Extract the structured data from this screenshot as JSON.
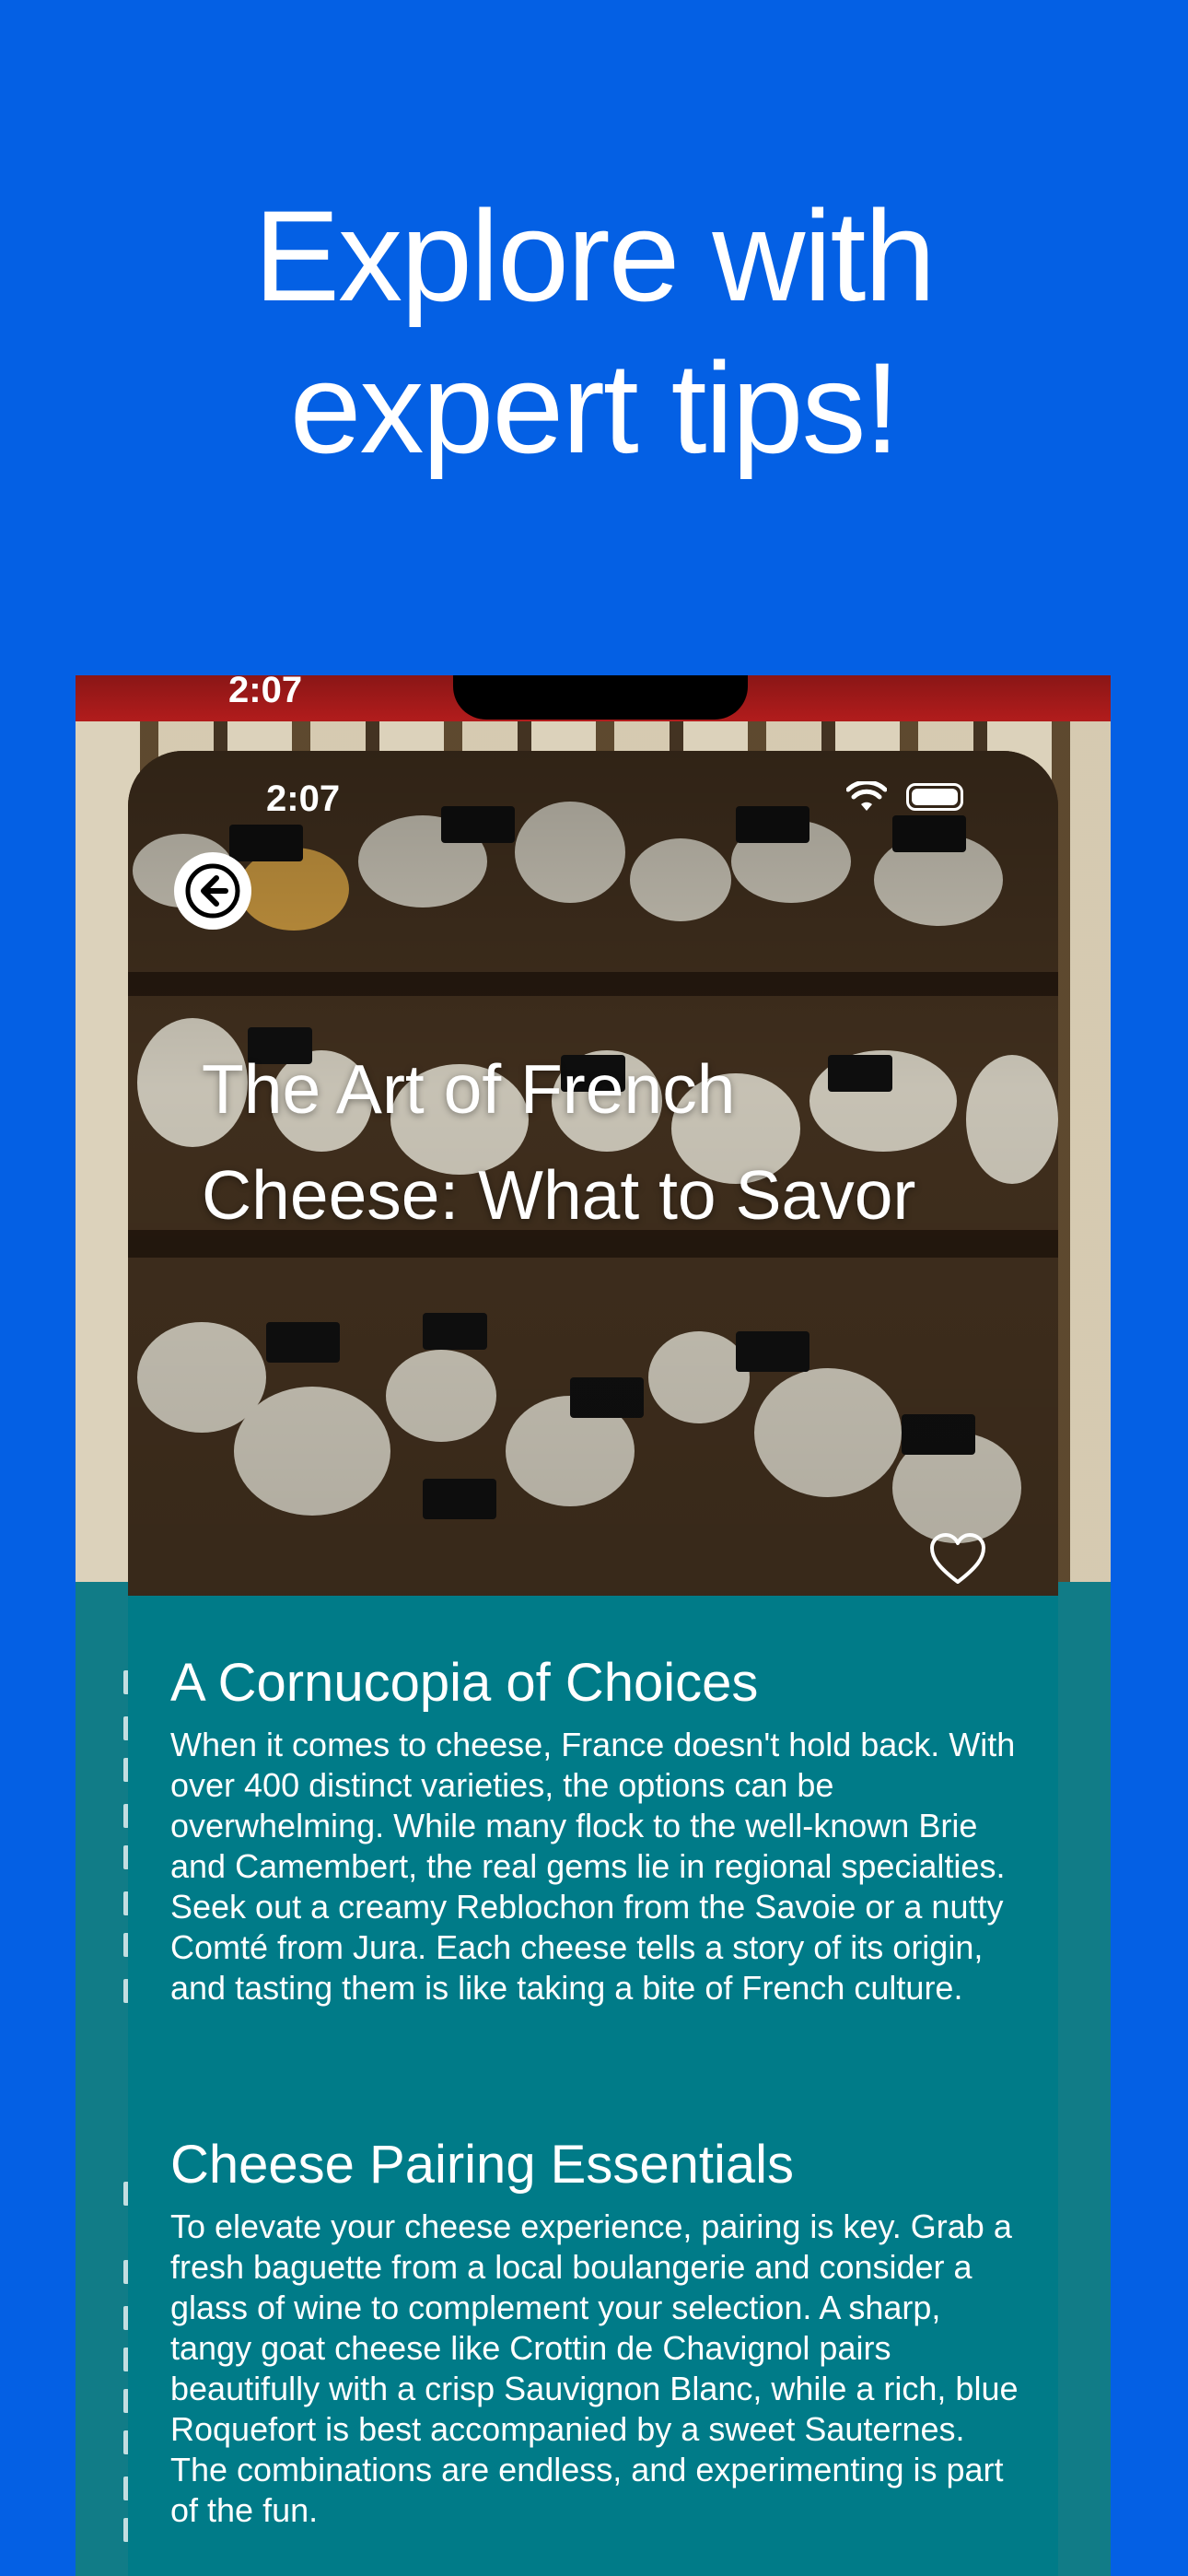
{
  "headline": {
    "line1": "Explore with",
    "line2": "expert tips!"
  },
  "back_device": {
    "time": "2:07"
  },
  "status_bar": {
    "time": "2:07"
  },
  "article": {
    "title_line1": "The Art of French",
    "title_line2": "Cheese: What to Savor",
    "sections": [
      {
        "heading": "A Cornucopia of Choices",
        "body": "When it comes to cheese, France doesn't hold back. With over 400 distinct varieties, the options can be overwhelming. While many flock to the well-known Brie and Camembert, the real gems lie in regional specialties. Seek out a creamy Reblochon from the Savoie or a nutty Comté from Jura. Each cheese tells a story of its origin, and tasting them is like taking a bite of French culture."
      },
      {
        "heading": "Cheese Pairing Essentials",
        "body": "To elevate your cheese experience, pairing is key. Grab a fresh baguette from a local boulangerie and consider a glass of wine to complement your selection. A sharp, tangy goat cheese like Crottin de Chavignol pairs beautifully with a crisp Sauvignon Blanc, while a rich, blue Roquefort is best accompanied by a sweet Sauternes. The combinations are endless, and experimenting is part of the fun."
      }
    ]
  },
  "icons": {
    "back": "arrow-left-icon",
    "favorite": "heart-icon",
    "wifi": "wifi-icon",
    "battery": "battery-icon"
  },
  "colors": {
    "background": "#0460E4",
    "content": "#007B88",
    "text": "#FFFFFF"
  }
}
